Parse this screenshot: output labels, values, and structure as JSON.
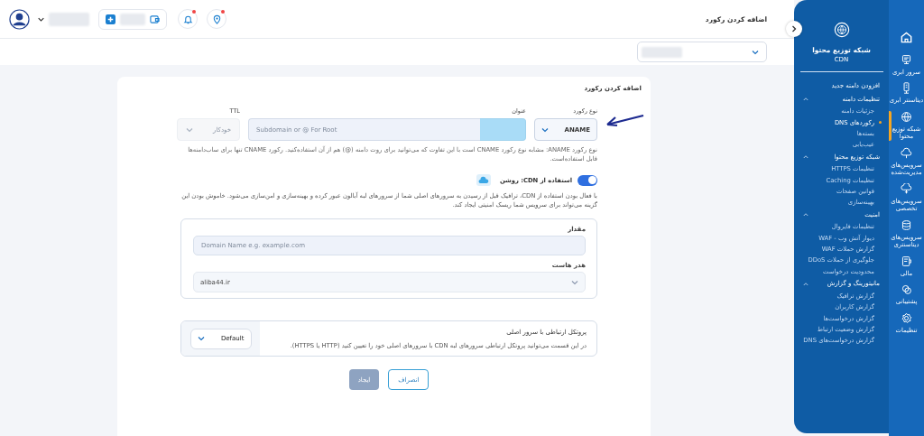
{
  "header": {
    "title": "اضافه کردن رکورد",
    "bell": {
      "unread": true
    },
    "location": {
      "unread": true
    }
  },
  "form": {
    "title": "اضافه کردن رکورد",
    "record_type": {
      "label": "نوع رکورد",
      "value": "ANAME"
    },
    "name": {
      "label": "عنوان",
      "placeholder": "Subdomain or @ For Root"
    },
    "ttl": {
      "label": "TTL",
      "placeholder": "خودکار",
      "disabled": true
    },
    "help": "نوع رکورد ANAME: مشابه نوع رکورد CNAME است با این تفاوت که می‌توانید برای روت دامنه (@) هم از آن استفاده‌کنید. رکورد CNAME تنها برای ساب‌دامنه‌ها قابل استفاده‌است.",
    "cdn": {
      "label": "استفاده از CDN: روشن",
      "on": true,
      "description": "با فعال بودن استفاده از CDN، ترافیک قبل از رسیدن به سرورهای اصلی شما از سرورهای لبه آبالون عبور کرده و بهینه‌سازی و امن‌سازی می‌شود. خاموش بودن این گزینه می‌تواند برای سرویس شما ریسک امنیتی ایجاد کند."
    },
    "value": {
      "label": "مقدار",
      "placeholder": "Domain Name e.g. example.com"
    },
    "host_header": {
      "label": "هدر هاست",
      "value": "aliba44.ir"
    },
    "protocol": {
      "title": "پروتکل ارتباطی با سرور اصلی",
      "description": "در این قسمت می‌توانید پروتکل ارتباطی سرورهای لبه CDN با سرورهای اصلی خود را تعیین کنید (HTTP یا HTTPS).",
      "value": "Default"
    },
    "buttons": [
      {
        "label": "انصراف",
        "kind": "secondary",
        "disabled": false
      },
      {
        "label": "ایجاد",
        "kind": "primary",
        "disabled": true
      }
    ]
  },
  "panel": {
    "title": "شبکه توزیع محتوا",
    "subtitle": "CDN",
    "items": [
      {
        "kind": "link",
        "label": "افزودن دامنه جدید"
      },
      {
        "kind": "group",
        "label": "تنظیمات دامنه",
        "expanded": true,
        "children": [
          {
            "label": "جزئیات دامنه",
            "selected": false
          },
          {
            "label": "رکوردهای DNS",
            "selected": true
          },
          {
            "label": "بسته‌ها",
            "selected": false
          },
          {
            "label": "عیب‌یابی",
            "selected": false
          }
        ]
      },
      {
        "kind": "group",
        "label": "شبکه توزیع محتوا",
        "expanded": true,
        "children": [
          {
            "label": "تنظیمات HTTPS",
            "selected": false
          },
          {
            "label": "تنظیمات Caching",
            "selected": false
          },
          {
            "label": "قوانین صفحات",
            "selected": false
          },
          {
            "label": "بهینه‌سازی",
            "selected": false
          }
        ]
      },
      {
        "kind": "group",
        "label": "امنیت",
        "expanded": true,
        "children": [
          {
            "label": "تنظیمات فایروال",
            "selected": false
          },
          {
            "label": "دیوار آتش وب - WAF",
            "selected": false
          },
          {
            "label": "گزارش حملات WAF",
            "selected": false
          },
          {
            "label": "جلوگیری از حملات DDoS",
            "selected": false
          },
          {
            "label": "محدودیت درخواست",
            "selected": false
          }
        ]
      },
      {
        "kind": "group",
        "label": "مانیتورینگ و گزارش",
        "expanded": true,
        "children": [
          {
            "label": "گزارش ترافیک",
            "selected": false
          },
          {
            "label": "گزارش کاربران",
            "selected": false
          },
          {
            "label": "گزارش درخواست‌ها",
            "selected": false
          },
          {
            "label": "گزارش وضعیت ارتباط",
            "selected": false
          },
          {
            "label": "گزارش درخواست‌های DNS",
            "selected": false
          }
        ]
      }
    ]
  },
  "rail": [
    {
      "label": "سرور ابری",
      "selected": false
    },
    {
      "label": "دیتاسنتر ابری",
      "selected": false
    },
    {
      "label": "شبکه توزیع محتوا",
      "selected": true
    },
    {
      "label": "سرویس‌های مدیریت‌شده",
      "selected": false
    },
    {
      "label": "سرویس‌های تخصصی",
      "selected": false
    },
    {
      "label": "سرویس‌های دیتاسنتری",
      "selected": false
    },
    {
      "label": "مالی",
      "selected": false
    },
    {
      "label": "پشتیبانی",
      "selected": false
    },
    {
      "label": "تنظیمات",
      "selected": false
    }
  ]
}
